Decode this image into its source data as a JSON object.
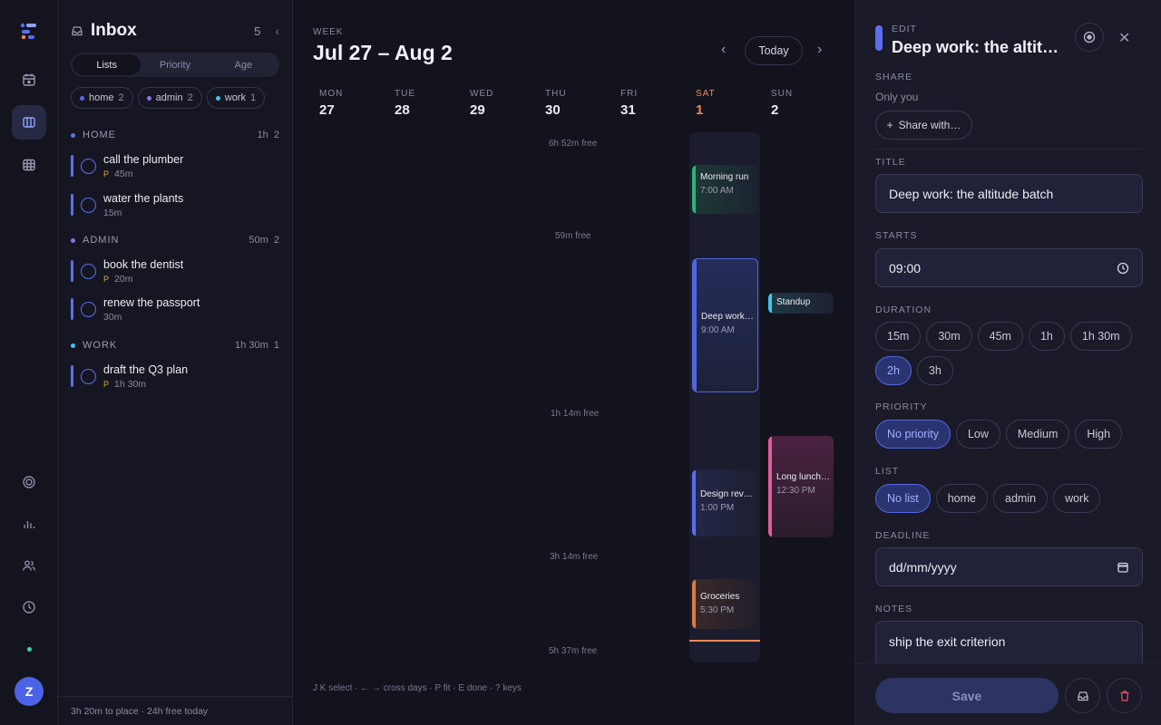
{
  "colors": {
    "accent": "#5b6ef0",
    "saturday": "#f08a56",
    "home": "#5b6ef0",
    "admin": "#8a72f0",
    "work": "#3ec6ee"
  },
  "rail": {
    "logo": "app-logo",
    "items": [
      "calendar-icon",
      "board-icon",
      "grid-icon",
      "target-icon",
      "chart-icon",
      "people-icon",
      "clock-icon"
    ],
    "avatar": "Z"
  },
  "inbox": {
    "title": "Inbox",
    "count": "5",
    "tabs": [
      "Lists",
      "Priority",
      "Age"
    ],
    "chips": [
      {
        "label": "home",
        "count": "2"
      },
      {
        "label": "admin",
        "count": "2"
      },
      {
        "label": "work",
        "count": "1"
      }
    ],
    "groups": [
      {
        "name": "HOME",
        "time": "1h",
        "count": "2",
        "tasks": [
          {
            "name": "call the plumber",
            "duration": "45m",
            "flag": "P"
          },
          {
            "name": "water the plants",
            "duration": "15m",
            "flag": ""
          }
        ]
      },
      {
        "name": "ADMIN",
        "time": "50m",
        "count": "2",
        "tasks": [
          {
            "name": "book the dentist",
            "duration": "20m",
            "flag": "P"
          },
          {
            "name": "renew the passport",
            "duration": "30m",
            "flag": ""
          }
        ]
      },
      {
        "name": "WORK",
        "time": "1h 30m",
        "count": "1",
        "tasks": [
          {
            "name": "draft the Q3 plan",
            "duration": "1h 30m",
            "flag": "P"
          }
        ]
      }
    ],
    "footer": "3h 20m to place · 24h free today"
  },
  "week": {
    "label": "WEEK",
    "range": "Jul 27 – Aug 2",
    "today": "Today",
    "days": [
      {
        "name": "MON",
        "date": "27"
      },
      {
        "name": "TUE",
        "date": "28"
      },
      {
        "name": "WED",
        "date": "29"
      },
      {
        "name": "THU",
        "date": "30"
      },
      {
        "name": "FRI",
        "date": "31"
      },
      {
        "name": "SAT",
        "date": "1"
      },
      {
        "name": "SUN",
        "date": "2"
      }
    ],
    "free": [
      "6h 52m free",
      "59m free",
      "1h 14m free",
      "3h 14m free",
      "5h 37m free"
    ],
    "events": [
      {
        "title": "Morning run",
        "time": "7:00 AM"
      },
      {
        "title": "Deep work: the altitude batch",
        "time": "9:00 AM"
      },
      {
        "title": "Standup",
        "time": ""
      },
      {
        "title": "Design review",
        "time": "1:00 PM"
      },
      {
        "title": "Long lunch with Ana",
        "time": "12:30 PM"
      },
      {
        "title": "Groceries",
        "time": "5:30 PM"
      }
    ],
    "hint": "J K select · ← → cross days · P fit · E done · ? keys"
  },
  "edit": {
    "label": "EDIT",
    "title": "Deep work: the altit…",
    "share_label": "SHARE",
    "share_value": "Only you",
    "share_button": "Share with…",
    "title_label": "TITLE",
    "title_value": "Deep work: the altitude batch",
    "starts_label": "STARTS",
    "starts_value": "09:00",
    "duration_label": "DURATION",
    "durations": [
      "15m",
      "30m",
      "45m",
      "1h",
      "1h 30m",
      "2h",
      "3h"
    ],
    "duration_selected": "2h",
    "priority_label": "PRIORITY",
    "priorities": [
      "No priority",
      "Low",
      "Medium",
      "High"
    ],
    "priority_selected": "No priority",
    "list_label": "LIST",
    "lists": [
      "No list",
      "home",
      "admin",
      "work"
    ],
    "list_selected": "No list",
    "deadline_label": "DEADLINE",
    "deadline_placeholder": "dd/mm/yyyy",
    "notes_label": "NOTES",
    "notes_value": "ship the exit criterion",
    "save": "Save"
  }
}
